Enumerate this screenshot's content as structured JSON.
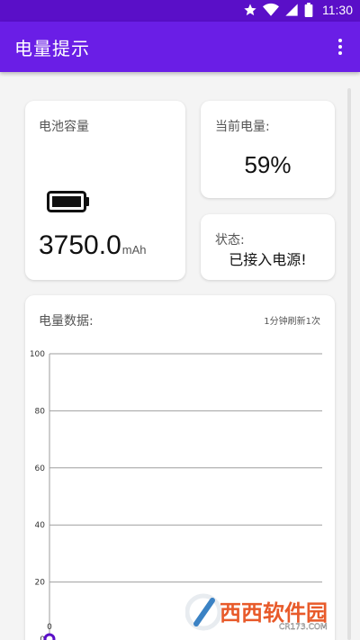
{
  "status_bar": {
    "time": "11:30",
    "icons": [
      "star-icon",
      "wifi-icon",
      "signal-icon",
      "battery-icon"
    ]
  },
  "app_bar": {
    "title": "电量提示",
    "menu_icon": "more-vert-icon"
  },
  "capacity_card": {
    "label": "电池容量",
    "value": "3750.0",
    "unit": "mAh",
    "icon": "battery-icon"
  },
  "current_card": {
    "label": "当前电量:",
    "value": "59%"
  },
  "status_card": {
    "label": "状态:",
    "value": "已接入电源!"
  },
  "chart_card": {
    "label": "电量数据:",
    "refresh_note": "1分钟刷新1次"
  },
  "chart_data": {
    "type": "line",
    "title": "",
    "xlabel": "",
    "ylabel": "",
    "ylim": [
      0,
      100
    ],
    "yticks": [
      0,
      20,
      40,
      60,
      80,
      100
    ],
    "grid": true,
    "series": [
      {
        "x": [
          0
        ],
        "values": [
          0
        ],
        "point_labels": [
          "0"
        ]
      }
    ],
    "colors": {
      "grid": "#9e9e9e",
      "point": "#5a0fc8"
    }
  },
  "watermark": {
    "text": "西西软件园",
    "subtext": "CR173.COM"
  },
  "colors": {
    "status_bar": "#5a0fc8",
    "app_bar": "#6a1ee6",
    "background": "#f4f4f4"
  }
}
